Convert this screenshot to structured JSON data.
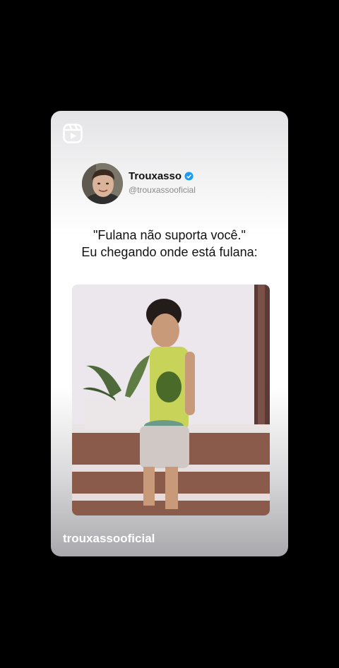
{
  "post": {
    "author_name": "Trouxasso",
    "author_handle": "@trouxassooficial",
    "quote_line1": "\"Fulana não suporta você.\"",
    "quote_line2": "Eu chegando onde está fulana:",
    "footer_username": "trouxassooficial"
  },
  "icons": {
    "reels": "reels-icon",
    "verified": "verified-badge-icon"
  },
  "colors": {
    "background": "#000000",
    "verified_blue": "#1d9bf0"
  }
}
